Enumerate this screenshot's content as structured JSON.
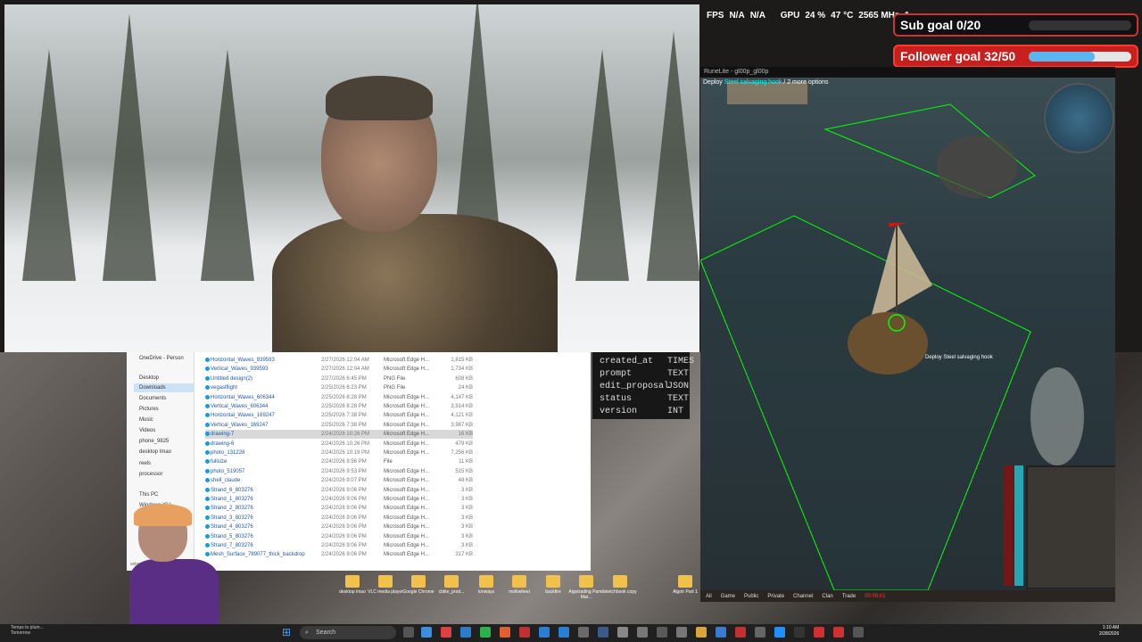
{
  "overlay": {
    "stats": {
      "fps_label": "FPS",
      "fps_val1": "N/A",
      "fps_val2": "N/A",
      "gpu_label": "GPU",
      "gpu_load": "24 %",
      "gpu_temp": "47 °C",
      "gpu_clock": "2565 MHz",
      "extra": "1."
    },
    "sub_goal": {
      "label": "Sub goal 0/20",
      "progress": 0.0
    },
    "follower_goal": {
      "label": "Follower goal 32/50",
      "progress": 0.64
    }
  },
  "game": {
    "window_title": "RuneLite - gl00p_gl00p",
    "chat_prefix": "Deploy",
    "chat_highlight": "Steel salvaging hook",
    "chat_suffix": "/ 2 more options",
    "hook_label": "Deploy Steel salvaging hook",
    "bottom_tabs": [
      "All",
      "Game",
      "Public",
      "Private",
      "Channel",
      "Clan",
      "Trade"
    ],
    "timer": "00:09:01",
    "colors": {
      "highlight": "#00ff00",
      "hp": "#7a1515",
      "prayer": "#27a6b3"
    }
  },
  "explorer": {
    "nav": [
      {
        "label": "OneDrive - Person"
      },
      {
        "label": "Desktop"
      },
      {
        "label": "Downloads"
      },
      {
        "label": "Documents"
      },
      {
        "label": "Pictures"
      },
      {
        "label": "Music"
      },
      {
        "label": "Videos"
      },
      {
        "label": "phone_9825"
      },
      {
        "label": "desktop Imao"
      },
      {
        "label": "reels"
      },
      {
        "label": "processor"
      },
      {
        "label": "This PC"
      },
      {
        "label": "Windows (C:)"
      }
    ],
    "files": [
      {
        "name": "Horizontal_Waves_939593",
        "date": "2/27/2026 12:04 AM",
        "type": "Microsoft Edge H...",
        "size": "1,815 KB"
      },
      {
        "name": "Vertical_Waves_939593",
        "date": "2/27/2026 12:04 AM",
        "type": "Microsoft Edge H...",
        "size": "1,734 KB"
      },
      {
        "name": "Untitled design(2)",
        "date": "2/27/2026 6:45 PM",
        "type": "PNG File",
        "size": "608 KB"
      },
      {
        "name": "vegaslflight",
        "date": "2/25/2026 6:23 PM",
        "type": "PNG File",
        "size": "24 KB"
      },
      {
        "name": "Horizontal_Waves_606344",
        "date": "2/25/2026 8:28 PM",
        "type": "Microsoft Edge H...",
        "size": "4,147 KB"
      },
      {
        "name": "Vertical_Waves_606344",
        "date": "2/25/2026 8:28 PM",
        "type": "Microsoft Edge H...",
        "size": "3,914 KB"
      },
      {
        "name": "Horizontal_Waves_169247",
        "date": "2/25/2026 7:38 PM",
        "type": "Microsoft Edge H...",
        "size": "4,121 KB"
      },
      {
        "name": "Vertical_Waves_169247",
        "date": "2/25/2026 7:38 PM",
        "type": "Microsoft Edge H...",
        "size": "3,987 KB"
      },
      {
        "name": "drawing-7",
        "date": "2/24/2026 10:26 PM",
        "type": "Microsoft Edge H...",
        "size": "16 KB"
      },
      {
        "name": "drawing-6",
        "date": "2/24/2026 10:26 PM",
        "type": "Microsoft Edge H...",
        "size": "479 KB"
      },
      {
        "name": "photo_131228",
        "date": "2/24/2026 10:19 PM",
        "type": "Microsoft Edge H...",
        "size": "7,256 KB"
      },
      {
        "name": "fullsize",
        "date": "2/24/2026 9:56 PM",
        "type": "File",
        "size": "11 KB"
      },
      {
        "name": "photo_519057",
        "date": "2/24/2026 9:53 PM",
        "type": "Microsoft Edge H...",
        "size": "515 KB"
      },
      {
        "name": "shell_claude",
        "date": "2/24/2026 9:07 PM",
        "type": "Microsoft Edge H...",
        "size": "48 KB"
      },
      {
        "name": "Strand_6_803276",
        "date": "2/24/2026 9:06 PM",
        "type": "Microsoft Edge H...",
        "size": "3 KB"
      },
      {
        "name": "Strand_1_803276",
        "date": "2/24/2026 9:06 PM",
        "type": "Microsoft Edge H...",
        "size": "3 KB"
      },
      {
        "name": "Strand_2_803276",
        "date": "2/24/2026 9:06 PM",
        "type": "Microsoft Edge H...",
        "size": "3 KB"
      },
      {
        "name": "Strand_3_803276",
        "date": "2/24/2026 9:06 PM",
        "type": "Microsoft Edge H...",
        "size": "3 KB"
      },
      {
        "name": "Strand_4_803276",
        "date": "2/24/2026 9:06 PM",
        "type": "Microsoft Edge H...",
        "size": "3 KB"
      },
      {
        "name": "Strand_5_803276",
        "date": "2/24/2026 9:06 PM",
        "type": "Microsoft Edge H...",
        "size": "3 KB"
      },
      {
        "name": "Strand_7_803276",
        "date": "2/24/2026 9:06 PM",
        "type": "Microsoft Edge H...",
        "size": "3 KB"
      },
      {
        "name": "Mesh_Surface_789077_thick_backdrop",
        "date": "2/24/2026 9:06 PM",
        "type": "Microsoft Edge H...",
        "size": "317 KB"
      }
    ],
    "selected_status": "selected  15.1 KB"
  },
  "schema": [
    {
      "name": "created_at",
      "type": "TIMES"
    },
    {
      "name": "prompt",
      "type": "TEXT"
    },
    {
      "name": "edit_proposal",
      "type": "JSON"
    },
    {
      "name": "status",
      "type": "TEXT"
    },
    {
      "name": "version",
      "type": "INT"
    }
  ],
  "desktop_icons": [
    {
      "label": "desktop imao"
    },
    {
      "label": "VLC media player"
    },
    {
      "label": "Google Chrome"
    },
    {
      "label": "cblite_prod..."
    },
    {
      "label": "tonways"
    },
    {
      "label": "molkwheel"
    },
    {
      "label": "backfire"
    },
    {
      "label": "Algotrading Pamil Mat..."
    },
    {
      "label": "sketchbook copy"
    },
    {
      "label": "Algotr Part 1"
    }
  ],
  "taskbar": {
    "search_placeholder": "Search",
    "weather_line1": "Temps to plum...",
    "weather_line2": "Tomorrow",
    "time": "1:10 AM",
    "date": "2/28/2026"
  }
}
